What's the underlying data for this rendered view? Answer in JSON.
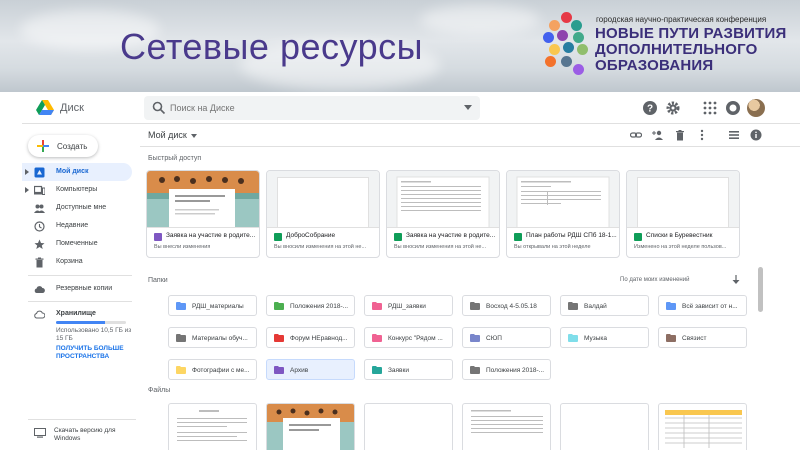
{
  "slide": {
    "title": "Сетевые ресурсы",
    "logo": {
      "small": "городская научно-практическая конференция",
      "line1": "НОВЫЕ ПУТИ РАЗВИТИЯ",
      "line2": "ДОПОЛНИТЕЛЬНОГО",
      "line3": "ОБРАЗОВАНИЯ",
      "dot_colors": [
        "#e63946",
        "#f4a261",
        "#2a9d8f",
        "#4361ee",
        "#8e44ad",
        "#43aa8b",
        "#f9c74f",
        "#277da1",
        "#90be6d",
        "#f3722c",
        "#577590",
        "#9b5de5"
      ]
    }
  },
  "app": {
    "name": "Диск",
    "search": {
      "placeholder": "Поиск на Диске"
    },
    "toolbar": {
      "location": "Мой диск"
    },
    "colors": {
      "accent": "#1a73e8",
      "active_bg": "#e8f0fe",
      "doc_purple": "#7e57c2",
      "sheet_green": "#0f9d58"
    }
  },
  "sidebar": {
    "create_label": "Создать",
    "items": [
      {
        "label": "Мой диск",
        "icon": "drive-icon",
        "active": true,
        "arrow": true
      },
      {
        "label": "Компьютеры",
        "icon": "computer-icon",
        "active": false,
        "arrow": true
      },
      {
        "label": "Доступные мне",
        "icon": "people-icon",
        "active": false,
        "arrow": false
      },
      {
        "label": "Недавние",
        "icon": "clock-icon",
        "active": false,
        "arrow": false
      },
      {
        "label": "Помеченные",
        "icon": "star-icon",
        "active": false,
        "arrow": false
      },
      {
        "label": "Корзина",
        "icon": "trash-icon",
        "active": false,
        "arrow": false
      }
    ],
    "backup_label": "Резервные копии",
    "storage": {
      "label": "Хранилище",
      "used_text": "Использовано 10,5 ГБ из 15 ГБ",
      "used_fraction": 0.7,
      "upgrade_link": "ПОЛУЧИТЬ БОЛЬШЕ ПРОСТРАНСТВА"
    },
    "download_text": "Скачать версию для Windows"
  },
  "quick_access": {
    "title": "Быстрый доступ",
    "items": [
      {
        "name": "Заявка на участие в родите...",
        "sub": "Вы внесли изменения",
        "type": "form"
      },
      {
        "name": "ДоброСобрание",
        "sub": "Вы вносили изменения на этой не...",
        "type": "sheet"
      },
      {
        "name": "Заявка на участие в родите...",
        "sub": "Вы вносили изменения на этой не...",
        "type": "sheet"
      },
      {
        "name": "План работы РДШ СПб 18-1...",
        "sub": "Вы открывали на этой неделе",
        "type": "sheet"
      },
      {
        "name": "Списки в Буревестник",
        "sub": "Изменено на этой неделе пользов...",
        "type": "sheet"
      }
    ]
  },
  "folders_section": {
    "title": "Папки",
    "sort_label": "По дате моих изменений",
    "folders": [
      {
        "name": "РДШ_материалы",
        "color": "#5e97f6",
        "selected": false
      },
      {
        "name": "Положения 2018-...",
        "color": "#4caf50",
        "selected": false
      },
      {
        "name": "РДШ_заявки",
        "color": "#f06292",
        "selected": false
      },
      {
        "name": "Восход 4-5.05.18",
        "color": "#757575",
        "selected": false
      },
      {
        "name": "Валдай",
        "color": "#757575",
        "selected": false
      },
      {
        "name": "Всё зависит от н...",
        "color": "#5e97f6",
        "selected": false
      },
      {
        "name": "Материалы обуч...",
        "color": "#757575",
        "selected": false
      },
      {
        "name": "Форум НЕравнод...",
        "color": "#e53935",
        "selected": false
      },
      {
        "name": "Конкурс \"Рядом ...",
        "color": "#f06292",
        "selected": false
      },
      {
        "name": "СЮП",
        "color": "#7986cb",
        "selected": false
      },
      {
        "name": "Музыка",
        "color": "#80deea",
        "selected": false
      },
      {
        "name": "Связист",
        "color": "#8d6e63",
        "selected": false
      },
      {
        "name": "Фотографии с ме...",
        "color": "#fdd663",
        "selected": false
      },
      {
        "name": "Архив",
        "color": "#7e57c2",
        "selected": true
      },
      {
        "name": "Заявки",
        "color": "#26a69a",
        "selected": false
      },
      {
        "name": "Положения 2018-...",
        "color": "#757575",
        "selected": false
      }
    ]
  },
  "files_section": {
    "title": "Файлы",
    "count": 6
  }
}
